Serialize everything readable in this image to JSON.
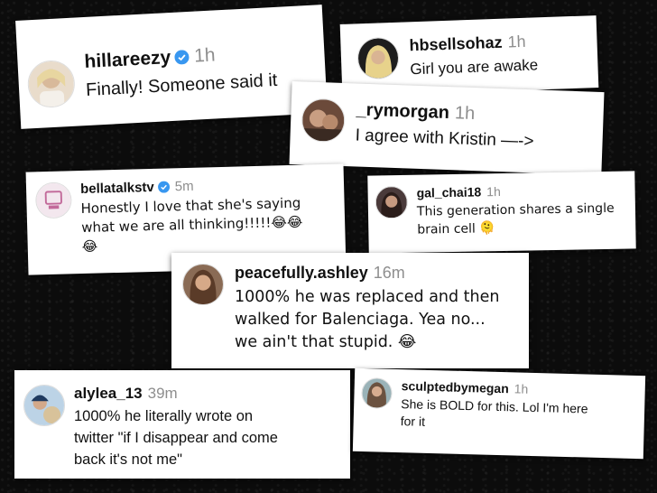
{
  "comments": [
    {
      "username": "hillareezy",
      "time": "1h",
      "verified": true,
      "text": "Finally! Someone said it"
    },
    {
      "username": "hbsellsohaz",
      "time": "1h",
      "verified": false,
      "text": "Girl you are awake"
    },
    {
      "username": "_rymorgan",
      "time": "1h",
      "verified": false,
      "text": "I agree with Kristin —->"
    },
    {
      "username": "bellatalkstv",
      "time": "5m",
      "verified": true,
      "text": "Honestly I love that she's saying\nwhat we are all thinking!!!!!😂😂\n😂"
    },
    {
      "username": "gal_chai18",
      "time": "1h",
      "verified": false,
      "text": "This generation shares a single\nbrain cell 🫠"
    },
    {
      "username": "peacefully.ashley",
      "time": "16m",
      "verified": false,
      "text": "1000% he was replaced and then\nwalked for Balenciaga. Yea no...\nwe ain't that stupid. 😂"
    },
    {
      "username": "alylea_13",
      "time": "39m",
      "verified": false,
      "text": "1000% he literally wrote on\ntwitter \"if I disappear and come\nback it's not me\""
    },
    {
      "username": "sculptedbymegan",
      "time": "1h",
      "verified": false,
      "text": "She is BOLD for this. Lol I'm here\nfor it"
    }
  ],
  "colors": {
    "verified": "#3897f0",
    "timestamp": "#8e8e8e",
    "card": "#ffffff",
    "background": "#0c0c0c"
  }
}
